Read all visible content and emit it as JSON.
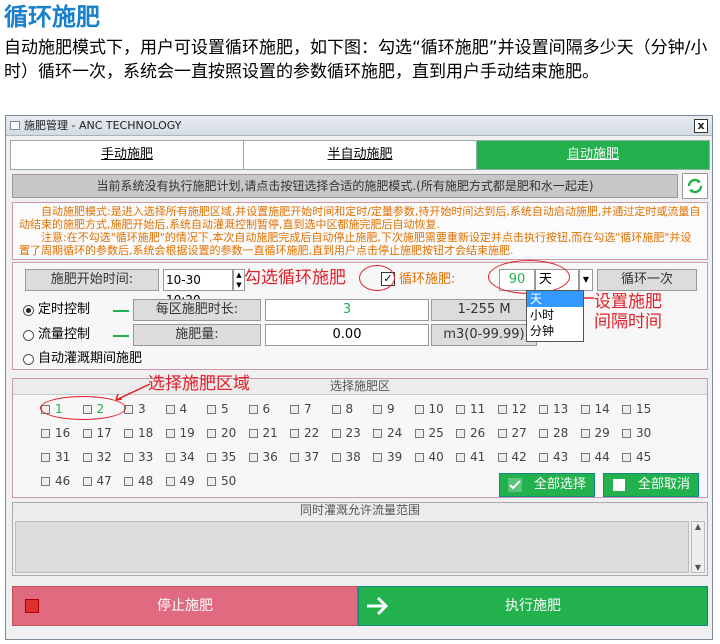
{
  "doc": {
    "title": "循环施肥",
    "text": "自动施肥模式下，用户可设置循环施肥，如下图：勾选“循环施肥”并设置间隔多少天（分钟/小时）循环一次，系统会一直按照设置的参数循环施肥，直到用户手动结束施肥。"
  },
  "window": {
    "title": "施肥管理 - ANC TECHNOLOGY",
    "close": "x"
  },
  "tabs": [
    {
      "label": "手动施肥"
    },
    {
      "label": "半自动施肥"
    },
    {
      "label": "自动施肥"
    }
  ],
  "status_message": "当前系统没有执行施肥计划,请点击按钮选择合适的施肥模式.(所有施肥方式都是肥和水一起走)",
  "mode_desc": {
    "p1": "自动施肥模式:是进入选择所有施肥区域,并设置施肥开始时间和定时/定量参数,待开始时间达到后,系统自动启动施肥,并通过定时或流量自动结束的施肥方式,施肥开始后,系统自动灌溉控制暂停,直到选中区都施完肥后自动恢复.",
    "p2": "注意:在不勾选\"循环施肥\"的情况下,本次自动施肥完成后自动停止施肥,下次施肥需要重新设定并点击执行按钮,而在勾选\"循环施肥\"并设置了周期循环的参数后,系统会根据设置的参数一直循环施肥,直到用户点击停止施肥按钮才会结束施肥."
  },
  "settings": {
    "start_label": "施肥开始时间:",
    "start_value": "10-30 10:20",
    "cycle_label": "循环施肥:",
    "interval_value": "90",
    "unit_selected": "天",
    "cycle_once": "循环一次",
    "timed_label": "定时控制",
    "flow_label": "流量控制",
    "auto_label": "自动灌溉期间施肥",
    "per_zone_label": "每区施肥时长:",
    "per_zone_value": "3",
    "per_zone_range": "1-255 M",
    "amount_label": "施肥量:",
    "amount_value": "0.00",
    "amount_range": "m3(0-99.99)"
  },
  "dropdown_options": [
    "天",
    "小时",
    "分钟"
  ],
  "annotations": {
    "check_cycle": "勾选循环施肥",
    "set_interval_1": "设置施肥",
    "set_interval_2": "间隔时间",
    "select_zone": "选择施肥区域"
  },
  "zones": {
    "header": "选择施肥区",
    "items": [
      "1",
      "2",
      "3",
      "4",
      "5",
      "6",
      "7",
      "8",
      "9",
      "10",
      "11",
      "12",
      "13",
      "14",
      "15",
      "16",
      "17",
      "18",
      "19",
      "20",
      "21",
      "22",
      "23",
      "24",
      "25",
      "26",
      "27",
      "28",
      "29",
      "30",
      "31",
      "32",
      "33",
      "34",
      "35",
      "36",
      "37",
      "38",
      "39",
      "40",
      "41",
      "42",
      "43",
      "44",
      "45",
      "46",
      "47",
      "48",
      "49",
      "50"
    ],
    "select_all": "全部选择",
    "deselect_all": "全部取消"
  },
  "flow_panel": {
    "header": "同时灌溉允许流量范围"
  },
  "actions": {
    "stop": "停止施肥",
    "execute": "执行施肥"
  },
  "colors": {
    "accent_green": "#22b14c",
    "stop_pink": "#e06b80",
    "annotation_red": "#e0202a",
    "title_blue": "#1a80cc"
  }
}
